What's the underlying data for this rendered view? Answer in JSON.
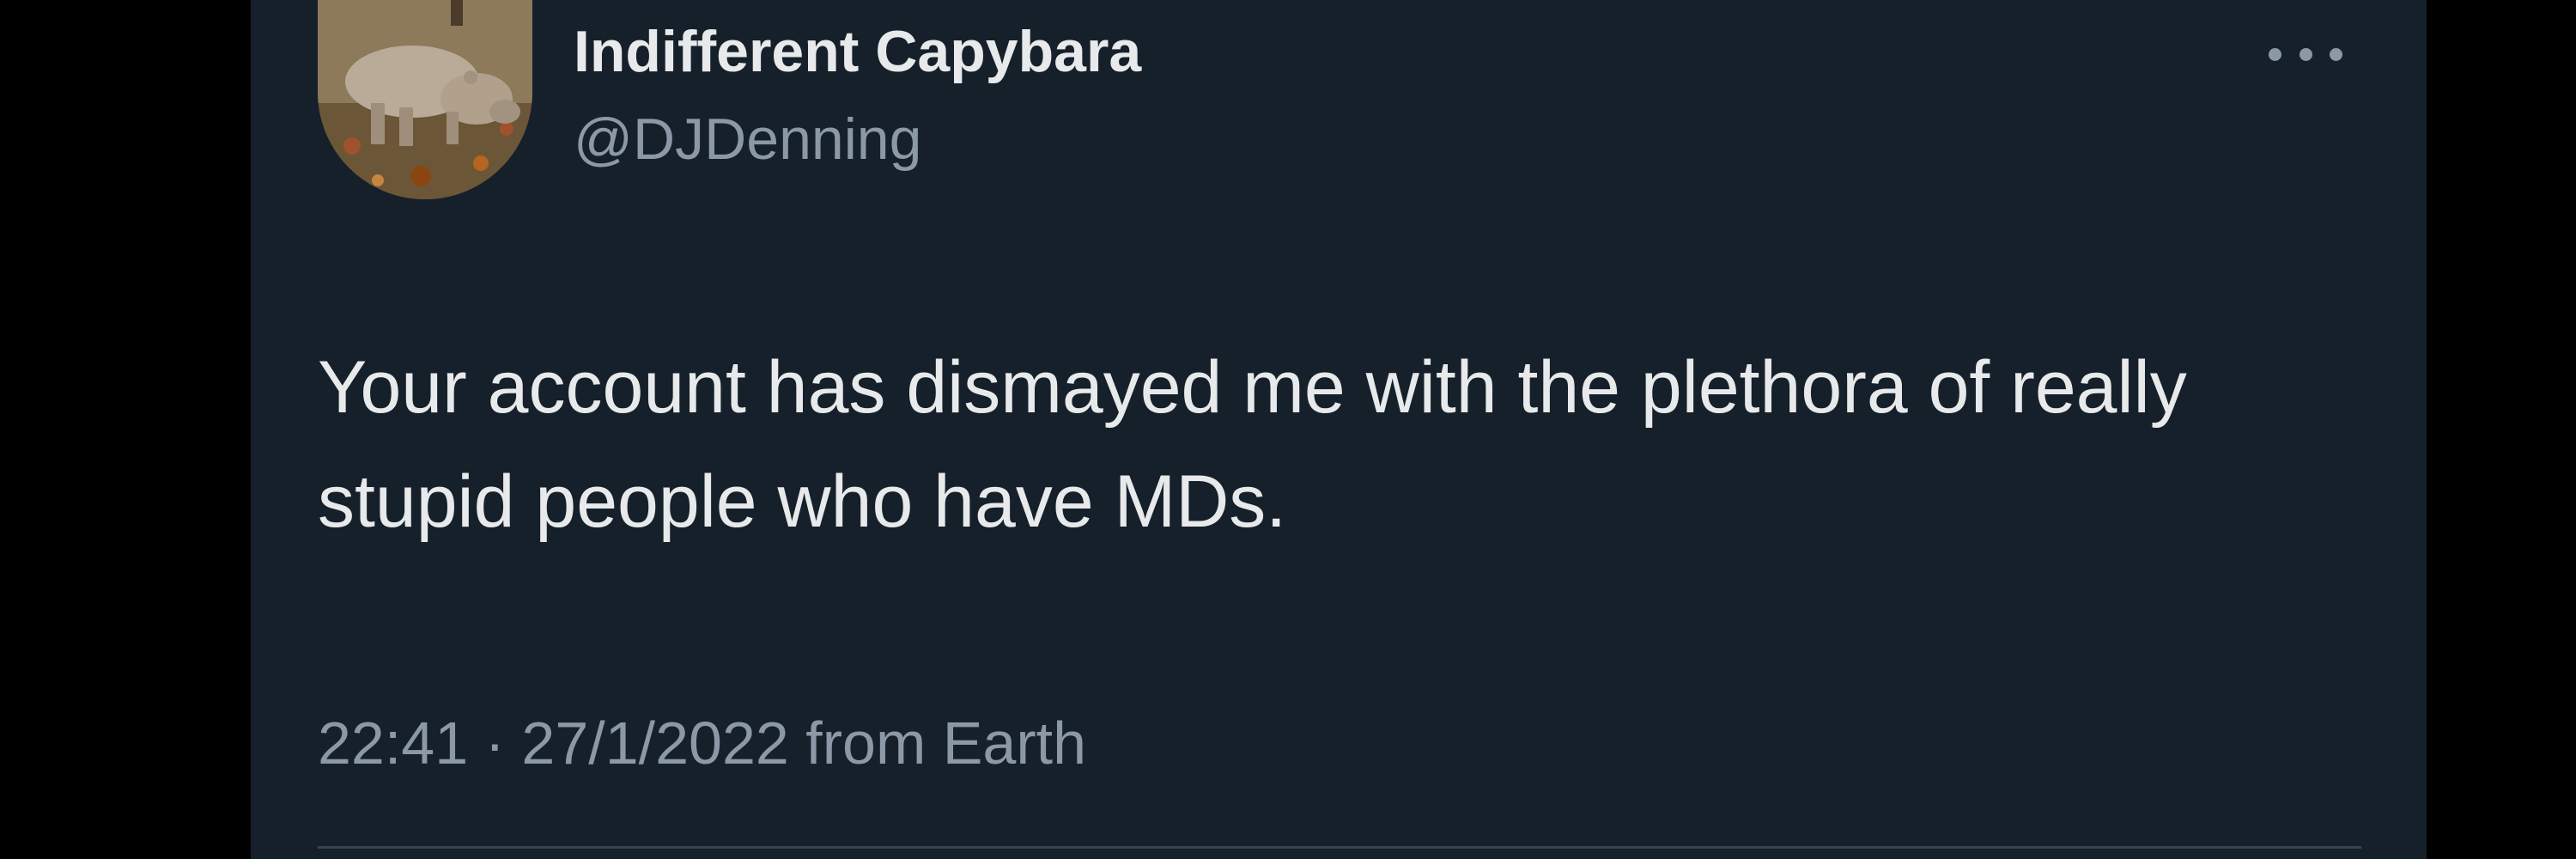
{
  "tweet": {
    "author": {
      "display_name": "Indifferent Capybara",
      "handle": "@DJDenning",
      "avatar": "capybara-photo"
    },
    "text": "Your account has dismayed me with the plethora of really stupid people who have MDs.",
    "time": "22:41",
    "separator": "·",
    "date": "27/1/2022",
    "source": "from Earth",
    "more_icon": "ellipsis-icon"
  },
  "colors": {
    "background": "#15202b",
    "outer_background": "#000000",
    "primary_text": "#e7e9ea",
    "secondary_text": "#8b98a5",
    "divider": "#38444d"
  }
}
